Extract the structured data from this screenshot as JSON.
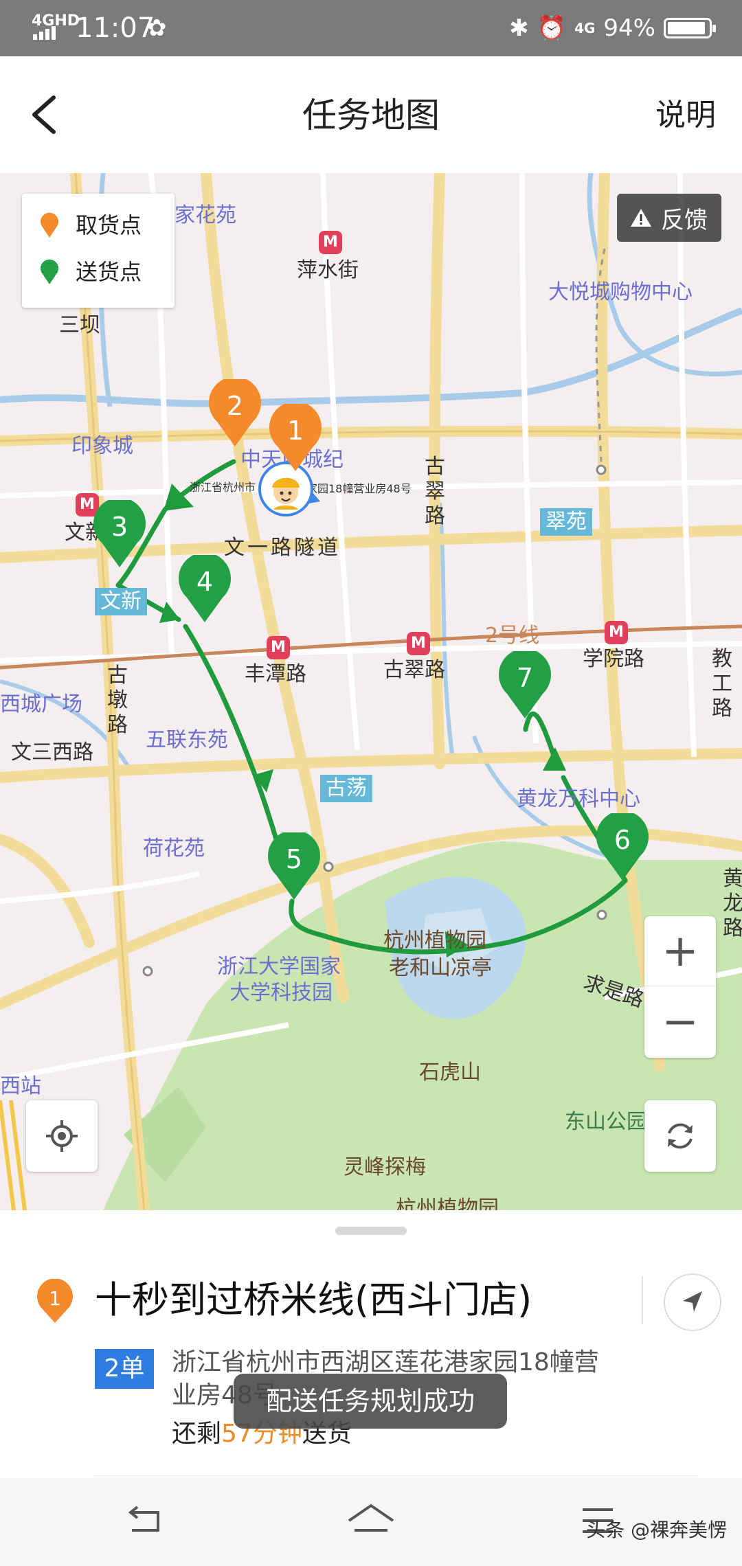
{
  "status_bar": {
    "network": "4GHD",
    "time": "11:07",
    "network_right": "4G",
    "battery": "94%"
  },
  "header": {
    "title": "任务地图",
    "help": "说明"
  },
  "legend": {
    "pickup": "取货点",
    "delivery": "送货点"
  },
  "feedback": "反馈",
  "colors": {
    "pickup": "#f58a2c",
    "delivery": "#22a045",
    "route": "#1f9a3c",
    "badge": "#2f7de1",
    "highlight": "#f08a24"
  },
  "map": {
    "labels": {
      "jiahuayuan": "家花苑",
      "pingshuijie": "萍水街",
      "dayuecheng": "大悦城购物中心",
      "sanba": "三坝",
      "yinxiangcheng": "印象城",
      "zhongtian": "中天西城纪",
      "gucui": "古翠路",
      "wenxin_left": "文新",
      "wenyi_tunnel": "文一路隧道",
      "cuiyuan": "翠苑",
      "wenxin_station": "文新",
      "line2": "2号线",
      "xueyuanlu": "学院路",
      "jiaogonglu": "教工路",
      "xichengguangchang": "西城广场",
      "gudunlu": "古墩路",
      "fengtanlu": "丰潭路",
      "gucuilu": "古翠路",
      "wenerxilu": "文三西路",
      "wuliandongyuan": "五联东苑",
      "gudang": "古荡",
      "huanglong": "黄龙万科中心",
      "hehuayuan": "荷花苑",
      "huanglonglu": "黄龙路",
      "zhiwuyuan": "杭州植物园",
      "laoheshan": "老和山凉亭",
      "zjukeji1": "浙江大学国家",
      "zjukeji2": "大学科技园",
      "qiushilu": "求是路",
      "shihushan": "石虎山",
      "dongshan": "东山公园",
      "xizhan": "西站",
      "lingfeng": "灵峰探梅",
      "zhiwuyuan2": "杭州植物园",
      "courier_addr_left": "浙江省杭州市",
      "courier_addr_right": "家园18幢营业房48号"
    },
    "markers": {
      "p1": "1",
      "p2": "2",
      "d3": "3",
      "d4": "4",
      "d5": "5",
      "d6": "6",
      "d7": "7"
    },
    "zoom_in": "+",
    "zoom_out": "−"
  },
  "task": {
    "index": "1",
    "shop": "十秒到过桥米线(西斗门店)",
    "order_badge": "2单",
    "address": "浙江省杭州市西湖区莲花港家园18幢营业房48号",
    "remain_prefix": "还剩",
    "remain_time": "57分钟",
    "remain_suffix": "送货"
  },
  "toast": "配送任务规划成功",
  "watermark": "头条 @裸奔美愣"
}
